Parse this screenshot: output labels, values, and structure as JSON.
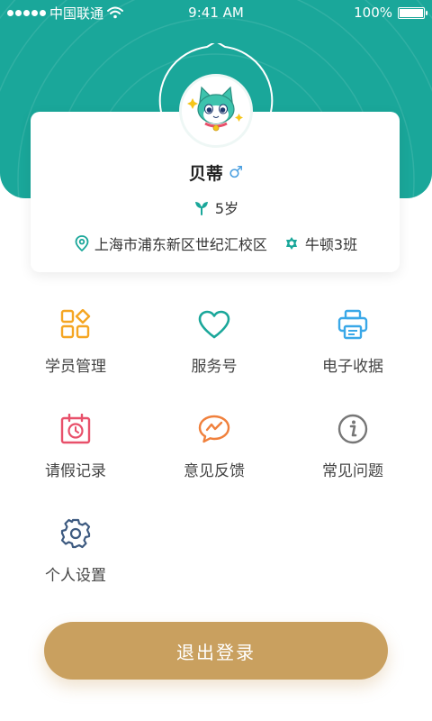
{
  "status_bar": {
    "carrier": "中国联通",
    "time": "9:41 AM",
    "battery": "100%"
  },
  "colors": {
    "header": "#1aa79a",
    "accent_gold": "#c9a05f",
    "teal": "#1aa79a",
    "orange": "#f5a623",
    "blue": "#3aa8e8",
    "red": "#e8506a",
    "gray": "#777777",
    "navy": "#3d5a80"
  },
  "profile": {
    "name": "贝蒂",
    "gender_symbol": "♂",
    "age": "5岁",
    "campus": "上海市浦东新区世纪汇校区",
    "class": "牛顿3班"
  },
  "menu": [
    {
      "label": "学员管理",
      "icon": "grid-apps-icon"
    },
    {
      "label": "服务号",
      "icon": "heart-icon"
    },
    {
      "label": "电子收据",
      "icon": "printer-icon"
    },
    {
      "label": "请假记录",
      "icon": "calendar-clock-icon"
    },
    {
      "label": "意见反馈",
      "icon": "chat-feedback-icon"
    },
    {
      "label": "常见问题",
      "icon": "info-icon"
    },
    {
      "label": "个人设置",
      "icon": "gear-icon"
    }
  ],
  "logout_label": "退出登录"
}
